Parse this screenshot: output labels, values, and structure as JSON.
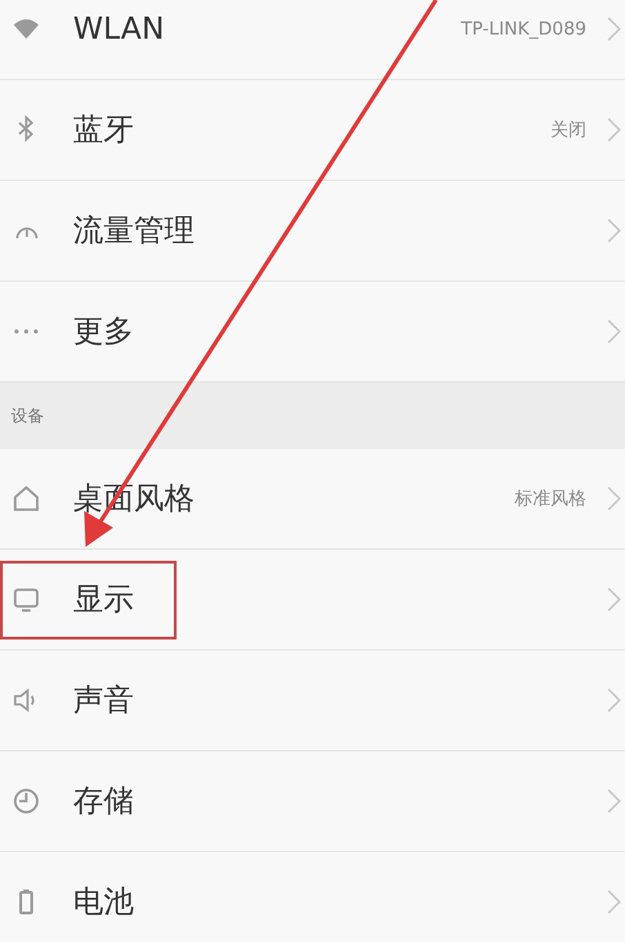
{
  "groups": [
    {
      "items": [
        {
          "label": "WLAN",
          "value": "TP-LINK_D089",
          "highlighted": false
        },
        {
          "label": "蓝牙",
          "value": "关闭",
          "highlighted": false
        },
        {
          "label": "流量管理",
          "highlighted": false
        },
        {
          "label": "更多",
          "highlighted": false
        }
      ]
    },
    {
      "header": "设备",
      "items": [
        {
          "label": "桌面风格",
          "value": "标准风格",
          "highlighted": false
        },
        {
          "label": "显示",
          "highlighted": true
        },
        {
          "label": "声音",
          "highlighted": false
        },
        {
          "label": "存储",
          "highlighted": false
        },
        {
          "label": "电池",
          "highlighted": false
        }
      ]
    }
  ]
}
